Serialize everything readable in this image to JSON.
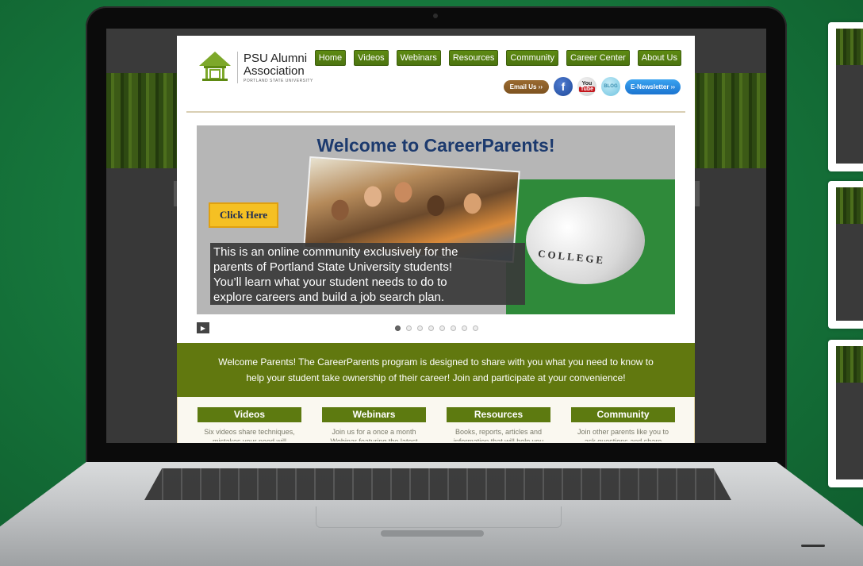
{
  "site": {
    "logo": {
      "line1": "PSU Alumni",
      "line2": "Association",
      "sub": "PORTLAND STATE UNIVERSITY"
    },
    "nav": [
      "Home",
      "Videos",
      "Webinars",
      "Resources",
      "Community",
      "Career Center",
      "About Us"
    ],
    "social": {
      "email": "Email Us ››",
      "facebook": "f",
      "youtube_top": "You",
      "youtube_bottom": "Tube",
      "blog": "BLOG",
      "newsletter": "E-Newsletter ››"
    },
    "hero": {
      "title": "Welcome to CareerParents!",
      "cta": "Click Here",
      "piggy_label": "COLLEGE",
      "caption_lines": [
        "This is an online community exclusively for the",
        "parents of  Portland State University students!",
        "You’ll learn what your student needs to do to",
        "explore careers and build a job search plan."
      ],
      "prev_glyph": "‹",
      "next_glyph": "›",
      "play_glyph": "▶",
      "slide_count": 8,
      "active_slide": 1
    },
    "welcome": {
      "line1": "Welcome Parents! The CareerParents program is designed to share with you what you need to know to",
      "line2": "help your student take ownership of their career! Join and participate at your convenience!"
    },
    "cards": [
      {
        "title": "Videos",
        "body": "Six videos share techniques, mistakes your need will"
      },
      {
        "title": "Webinars",
        "body": "Join us for a once a month Webinar featuring the latest"
      },
      {
        "title": "Resources",
        "body": "Books, reports, articles and information that will help you"
      },
      {
        "title": "Community",
        "body": "Join other parents like you to ask questions and share"
      }
    ]
  },
  "colors": {
    "nav_green": "#4c7410",
    "band_green": "#61780f",
    "title_blue": "#1c3a6e",
    "cta_yellow": "#f5c023",
    "background_green": "#177a3e"
  }
}
